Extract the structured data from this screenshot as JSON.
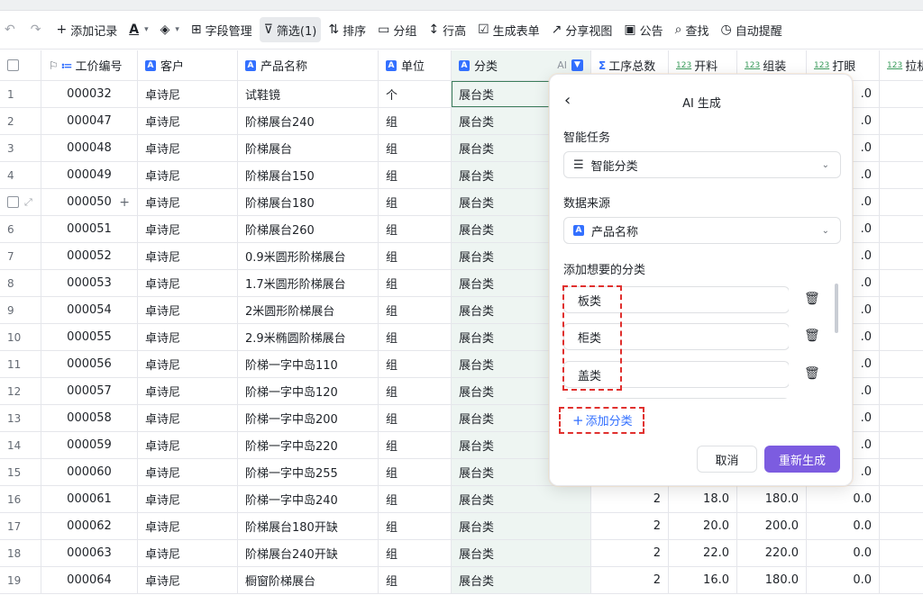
{
  "toolbar": {
    "add_record": "添加记录",
    "field_manage": "字段管理",
    "filter": "筛选(1)",
    "sort": "排序",
    "group": "分组",
    "row_height": "行高",
    "form": "生成表单",
    "share": "分享视图",
    "notice": "公告",
    "search": "查找",
    "reminder": "自动提醒"
  },
  "columns": {
    "code": "工价编号",
    "customer": "客户",
    "product": "产品名称",
    "unit": "单位",
    "category": "分类",
    "category_ai": "AI",
    "steps": "工序总数",
    "open": "开料",
    "assemble": "组装",
    "eye": "打眼",
    "pull": "拉机"
  },
  "rows": [
    {
      "idx": "1",
      "code": "000032",
      "customer": "卓诗尼",
      "product": "试鞋镜",
      "unit": "个",
      "category": "展台类",
      "steps": "",
      "open": "",
      "asm": "",
      "eye": ".0",
      "pull": ""
    },
    {
      "idx": "2",
      "code": "000047",
      "customer": "卓诗尼",
      "product": "阶梯展台240",
      "unit": "组",
      "category": "展台类",
      "steps": "",
      "open": "",
      "asm": "",
      "eye": ".0",
      "pull": ""
    },
    {
      "idx": "3",
      "code": "000048",
      "customer": "卓诗尼",
      "product": "阶梯展台",
      "unit": "组",
      "category": "展台类",
      "steps": "",
      "open": "",
      "asm": "",
      "eye": ".0",
      "pull": ""
    },
    {
      "idx": "4",
      "code": "000049",
      "customer": "卓诗尼",
      "product": "阶梯展台150",
      "unit": "组",
      "category": "展台类",
      "steps": "",
      "open": "",
      "asm": "",
      "eye": ".0",
      "pull": ""
    },
    {
      "idx": "",
      "code": "000050",
      "customer": "卓诗尼",
      "product": "阶梯展台180",
      "unit": "组",
      "category": "展台类",
      "steps": "",
      "open": "",
      "asm": "",
      "eye": ".0",
      "pull": ""
    },
    {
      "idx": "6",
      "code": "000051",
      "customer": "卓诗尼",
      "product": "阶梯展台260",
      "unit": "组",
      "category": "展台类",
      "steps": "",
      "open": "",
      "asm": "",
      "eye": ".0",
      "pull": ""
    },
    {
      "idx": "7",
      "code": "000052",
      "customer": "卓诗尼",
      "product": "0.9米圆形阶梯展台",
      "unit": "组",
      "category": "展台类",
      "steps": "",
      "open": "",
      "asm": "",
      "eye": ".0",
      "pull": ""
    },
    {
      "idx": "8",
      "code": "000053",
      "customer": "卓诗尼",
      "product": "1.7米圆形阶梯展台",
      "unit": "组",
      "category": "展台类",
      "steps": "",
      "open": "",
      "asm": "",
      "eye": ".0",
      "pull": ""
    },
    {
      "idx": "9",
      "code": "000054",
      "customer": "卓诗尼",
      "product": "2米圆形阶梯展台",
      "unit": "组",
      "category": "展台类",
      "steps": "",
      "open": "",
      "asm": "",
      "eye": ".0",
      "pull": ""
    },
    {
      "idx": "10",
      "code": "000055",
      "customer": "卓诗尼",
      "product": "2.9米椭圆阶梯展台",
      "unit": "组",
      "category": "展台类",
      "steps": "",
      "open": "",
      "asm": "",
      "eye": ".0",
      "pull": ""
    },
    {
      "idx": "11",
      "code": "000056",
      "customer": "卓诗尼",
      "product": "阶梯一字中岛110",
      "unit": "组",
      "category": "展台类",
      "steps": "",
      "open": "",
      "asm": "",
      "eye": ".0",
      "pull": ""
    },
    {
      "idx": "12",
      "code": "000057",
      "customer": "卓诗尼",
      "product": "阶梯一字中岛120",
      "unit": "组",
      "category": "展台类",
      "steps": "",
      "open": "",
      "asm": "",
      "eye": ".0",
      "pull": ""
    },
    {
      "idx": "13",
      "code": "000058",
      "customer": "卓诗尼",
      "product": "阶梯一字中岛200",
      "unit": "组",
      "category": "展台类",
      "steps": "",
      "open": "",
      "asm": "",
      "eye": ".0",
      "pull": ""
    },
    {
      "idx": "14",
      "code": "000059",
      "customer": "卓诗尼",
      "product": "阶梯一字中岛220",
      "unit": "组",
      "category": "展台类",
      "steps": "",
      "open": "",
      "asm": "",
      "eye": ".0",
      "pull": ""
    },
    {
      "idx": "15",
      "code": "000060",
      "customer": "卓诗尼",
      "product": "阶梯一字中岛255",
      "unit": "组",
      "category": "展台类",
      "steps": "",
      "open": "",
      "asm": "",
      "eye": ".0",
      "pull": ""
    },
    {
      "idx": "16",
      "code": "000061",
      "customer": "卓诗尼",
      "product": "阶梯一字中岛240",
      "unit": "组",
      "category": "展台类",
      "steps": "2",
      "open": "18.0",
      "asm": "180.0",
      "eye": "0.0",
      "pull": ""
    },
    {
      "idx": "17",
      "code": "000062",
      "customer": "卓诗尼",
      "product": "阶梯展台180开缺",
      "unit": "组",
      "category": "展台类",
      "steps": "2",
      "open": "20.0",
      "asm": "200.0",
      "eye": "0.0",
      "pull": ""
    },
    {
      "idx": "18",
      "code": "000063",
      "customer": "卓诗尼",
      "product": "阶梯展台240开缺",
      "unit": "组",
      "category": "展台类",
      "steps": "2",
      "open": "22.0",
      "asm": "220.0",
      "eye": "0.0",
      "pull": ""
    },
    {
      "idx": "19",
      "code": "000064",
      "customer": "卓诗尼",
      "product": "橱窗阶梯展台",
      "unit": "组",
      "category": "展台类",
      "steps": "2",
      "open": "16.0",
      "asm": "180.0",
      "eye": "0.0",
      "pull": ""
    }
  ],
  "panel": {
    "title": "AI 生成",
    "task_label": "智能任务",
    "task_value": "智能分类",
    "source_label": "数据来源",
    "source_value": "产品名称",
    "categories_label": "添加想要的分类",
    "categories": [
      "板类",
      "柜类",
      "盖类"
    ],
    "add_category": "添加分类",
    "cancel": "取消",
    "regenerate": "重新生成"
  },
  "colors": {
    "accent": "#3370ff",
    "primary_button": "#7c5ce0",
    "annotation": "#e0302e"
  }
}
